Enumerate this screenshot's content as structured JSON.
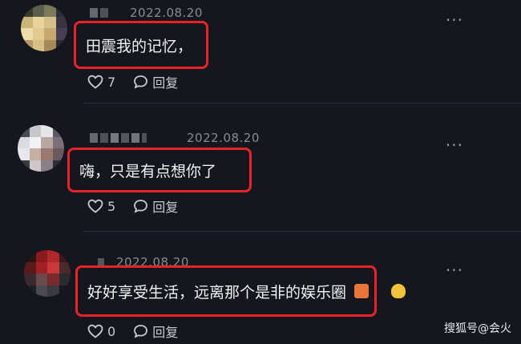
{
  "comments": [
    {
      "date": "2022.08.20",
      "text": "田震我的记忆，",
      "likes": "7",
      "reply_label": "回复"
    },
    {
      "date": "2022.08.20",
      "text": "嗨，只是有点想你了",
      "likes": "5",
      "reply_label": "回复"
    },
    {
      "date": "2022.08.20",
      "text": "好好享受生活，远离那个是非的娱乐圈",
      "likes": "0",
      "reply_label": "回复"
    }
  ],
  "more_label": "···",
  "watermark": "搜狐号@会火",
  "colors": {
    "highlight_border": "#e8242a",
    "background": "#16161f"
  }
}
